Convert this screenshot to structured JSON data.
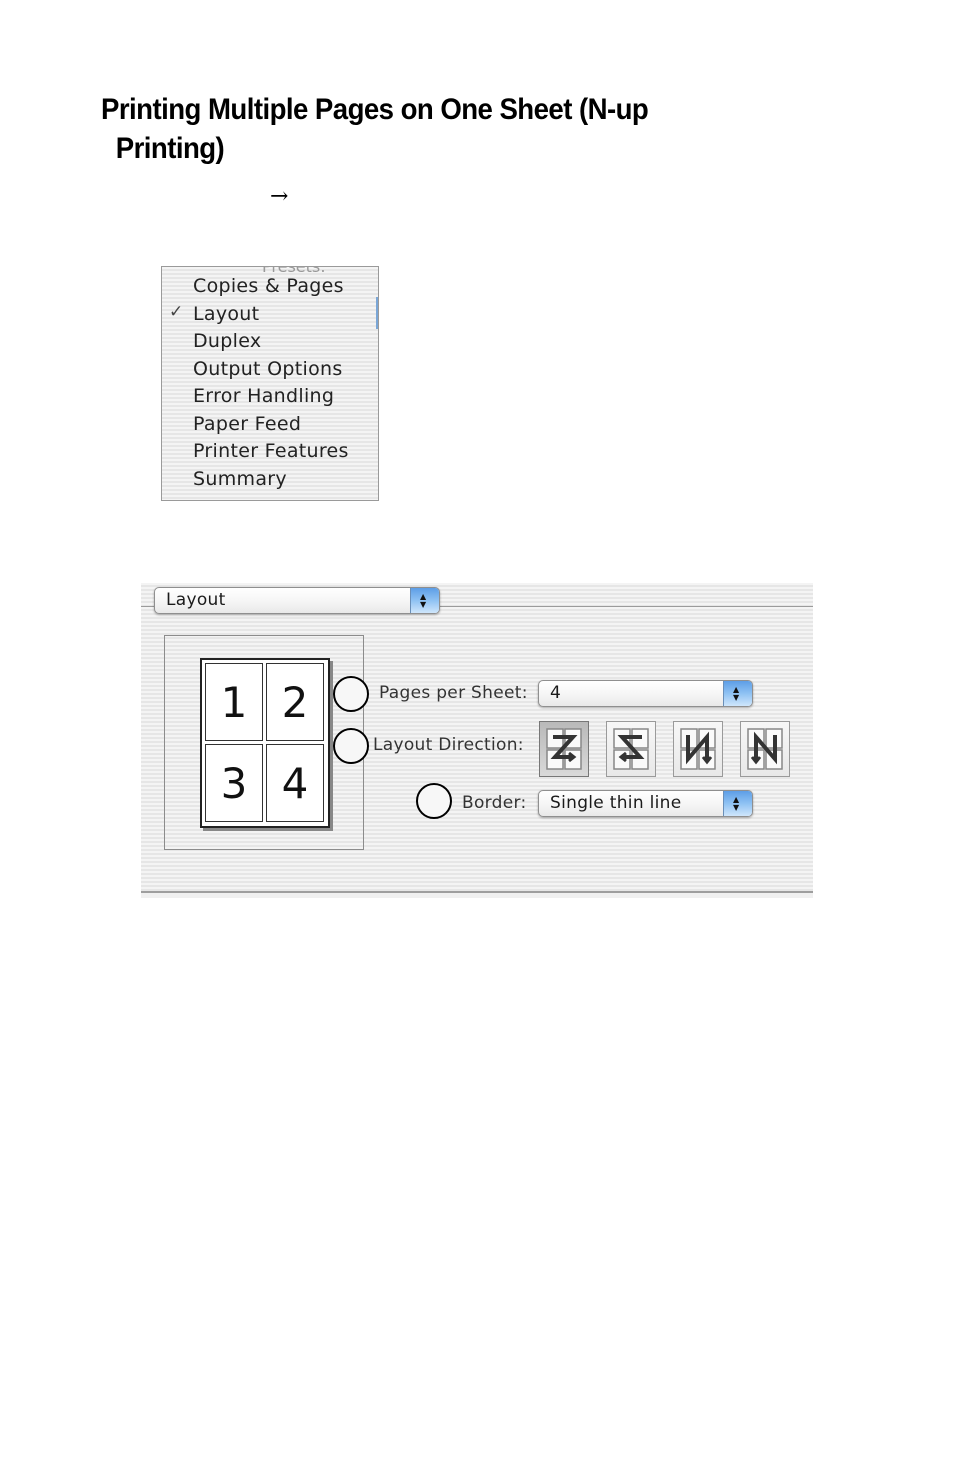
{
  "document": {
    "heading_line1": "Printing Multiple Pages on One Sheet (N-up",
    "heading_line2": "Printing)",
    "arrow": "→"
  },
  "popup_menu": {
    "partial_top_label": "Presets:",
    "items": [
      {
        "label": "Copies & Pages",
        "checked": false
      },
      {
        "label": "Layout",
        "checked": true
      },
      {
        "label": "Duplex",
        "checked": false
      },
      {
        "label": "Output Options",
        "checked": false
      },
      {
        "label": "Error Handling",
        "checked": false
      },
      {
        "label": "Paper Feed",
        "checked": false
      },
      {
        "label": "Printer Features",
        "checked": false
      },
      {
        "label": "Summary",
        "checked": false
      }
    ],
    "check_glyph": "✓"
  },
  "layout_panel": {
    "panel_select": {
      "value": "Layout"
    },
    "preview_pages": [
      "1",
      "2",
      "3",
      "4"
    ],
    "pages_per_sheet": {
      "label": "Pages per Sheet:",
      "value": "4"
    },
    "layout_direction": {
      "label": "Layout Direction:",
      "options": [
        {
          "name": "left-right-top-bottom",
          "selected": true
        },
        {
          "name": "right-left-top-bottom",
          "selected": false
        },
        {
          "name": "top-bottom-left-right",
          "selected": false
        },
        {
          "name": "top-bottom-right-left",
          "selected": false
        }
      ]
    },
    "border": {
      "label": "Border:",
      "value": "Single thin line"
    },
    "stepper_up": "▲",
    "stepper_down": "▼"
  }
}
